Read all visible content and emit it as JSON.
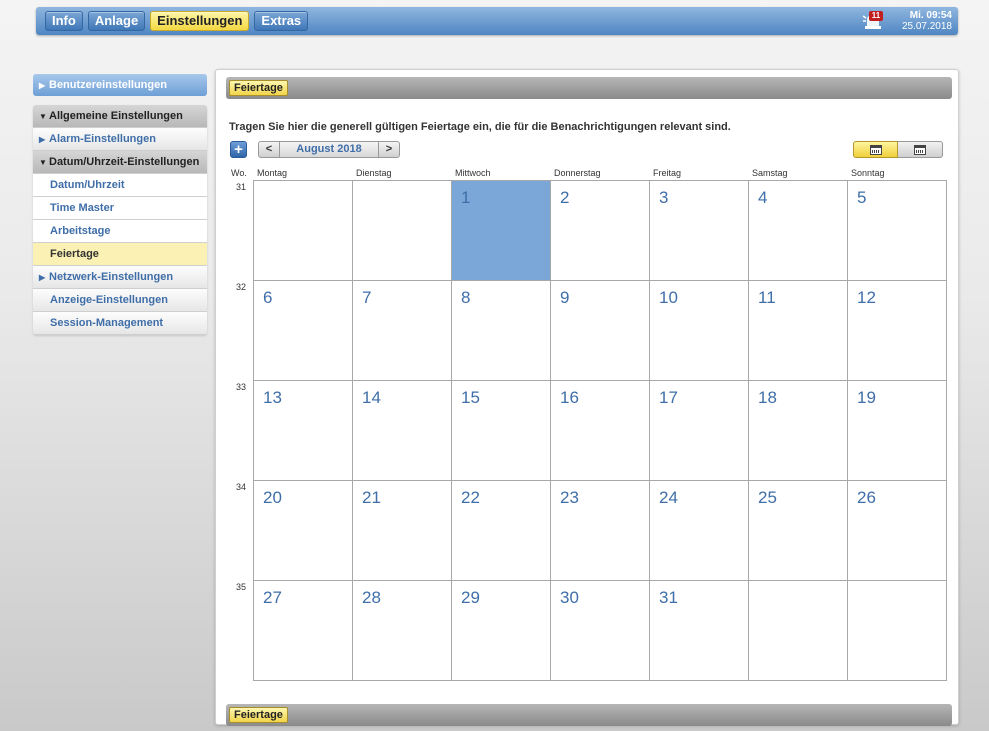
{
  "topbar": {
    "tabs": [
      {
        "label": "Info",
        "active": false
      },
      {
        "label": "Anlage",
        "active": false
      },
      {
        "label": "Einstellungen",
        "active": true
      },
      {
        "label": "Extras",
        "active": false
      }
    ],
    "alarm_count": "11",
    "clock_time": "Mi. 09:54",
    "clock_date": "25.07.2018"
  },
  "sidebar": {
    "user_settings": "Benutzereinstellungen",
    "general_settings": "Allgemeine Einstellungen",
    "alarm_settings": "Alarm-Einstellungen",
    "datetime_settings": "Datum/Uhrzeit-Einstellungen",
    "datetime": "Datum/Uhrzeit",
    "time_master": "Time Master",
    "workdays": "Arbeitstage",
    "holidays": "Feiertage",
    "network_settings": "Netzwerk-Einstellungen",
    "display_settings": "Anzeige-Einstellungen",
    "session_management": "Session-Management"
  },
  "main": {
    "tab_label": "Feiertage",
    "footer_label": "Feiertage",
    "instruction": "Tragen Sie hier die generell gültigen Feiertage ein, die für die Benachrichtigungen relevant sind.",
    "add_symbol": "+",
    "prev_symbol": "<",
    "next_symbol": ">",
    "month_label": "August 2018"
  },
  "calendar": {
    "week_header": "Wo.",
    "weekdays": [
      "Montag",
      "Dienstag",
      "Mittwoch",
      "Donnerstag",
      "Freitag",
      "Samstag",
      "Sonntag"
    ],
    "weeks": [
      {
        "week": "31",
        "days": [
          "",
          "",
          "1",
          "2",
          "3",
          "4",
          "5"
        ]
      },
      {
        "week": "32",
        "days": [
          "6",
          "7",
          "8",
          "9",
          "10",
          "11",
          "12"
        ]
      },
      {
        "week": "33",
        "days": [
          "13",
          "14",
          "15",
          "16",
          "17",
          "18",
          "19"
        ]
      },
      {
        "week": "34",
        "days": [
          "20",
          "21",
          "22",
          "23",
          "24",
          "25",
          "26"
        ]
      },
      {
        "week": "35",
        "days": [
          "27",
          "28",
          "29",
          "30",
          "31",
          "",
          ""
        ]
      }
    ],
    "highlighted_day": "1",
    "highlight_color": "#7aa6d8",
    "day_number_color": "#3f6ea8"
  },
  "icons": {
    "alarm": "alarm-light-icon",
    "calendar_month": "calendar-month-icon",
    "calendar_week": "calendar-week-icon"
  }
}
